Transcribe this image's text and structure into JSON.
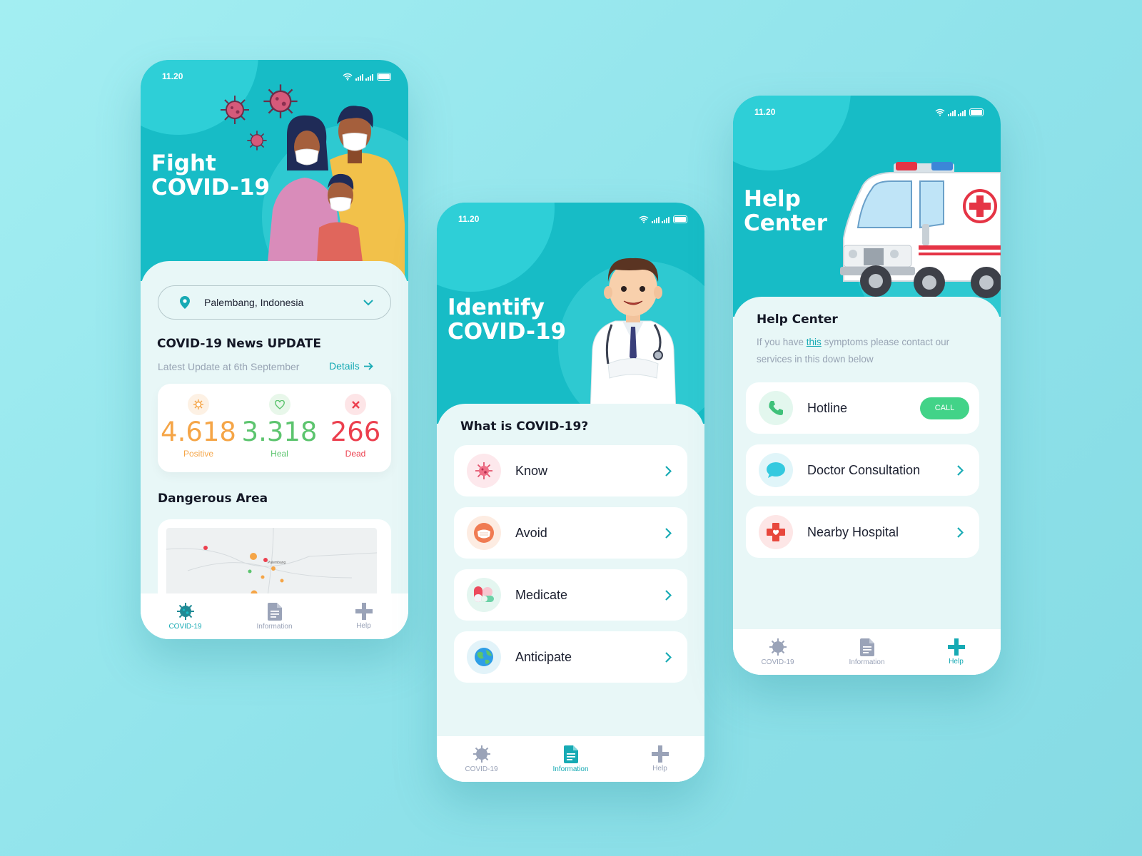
{
  "screen1": {
    "status_time": "11.20",
    "hero_title_1": "Fight",
    "hero_title_2": "COVID-19",
    "location": "Palembang, Indonesia",
    "news_title": "COVID-19 News UPDATE",
    "latest_update": "Latest Update at 6th September",
    "details_link": "Details",
    "stats": [
      {
        "value": "4.618",
        "label": "Positive",
        "color": "#f5a547"
      },
      {
        "value": "3.318",
        "label": "Heal",
        "color": "#5cc46e"
      },
      {
        "value": "266",
        "label": "Dead",
        "color": "#ec3f4e"
      }
    ],
    "dangerous_title": "Dangerous Area",
    "map_labels": [
      "Palembang"
    ],
    "nav": [
      "COVID-19",
      "Information",
      "Help"
    ]
  },
  "screen2": {
    "status_time": "11.20",
    "hero_title_1": "Identify",
    "hero_title_2": "COVID-19",
    "section_title": "What is COVID-19?",
    "items": [
      {
        "label": "Know",
        "icon": "virus-icon"
      },
      {
        "label": "Avoid",
        "icon": "mask-icon"
      },
      {
        "label": "Medicate",
        "icon": "pills-icon"
      },
      {
        "label": "Anticipate",
        "icon": "globe-icon"
      }
    ],
    "nav": [
      "COVID-19",
      "Information",
      "Help"
    ]
  },
  "screen3": {
    "status_time": "11.20",
    "hero_title_1": "Help",
    "hero_title_2": "Center",
    "section_title": "Help Center",
    "desc_1": "If you have ",
    "desc_link": "this",
    "desc_2": " symptoms please contact our services in this down below",
    "items": [
      {
        "label": "Hotline",
        "icon": "phone-icon"
      },
      {
        "label": "Doctor Consultation",
        "icon": "chat-bubble-icon"
      },
      {
        "label": "Nearby Hospital",
        "icon": "medical-cross-icon"
      }
    ],
    "call_button": "CALL",
    "nav": [
      "COVID-19",
      "Information",
      "Help"
    ]
  },
  "colors": {
    "teal": "#17bcc6",
    "teal_light": "#2ecfd7",
    "accent": "#17aab4",
    "call_green": "#42d388"
  }
}
